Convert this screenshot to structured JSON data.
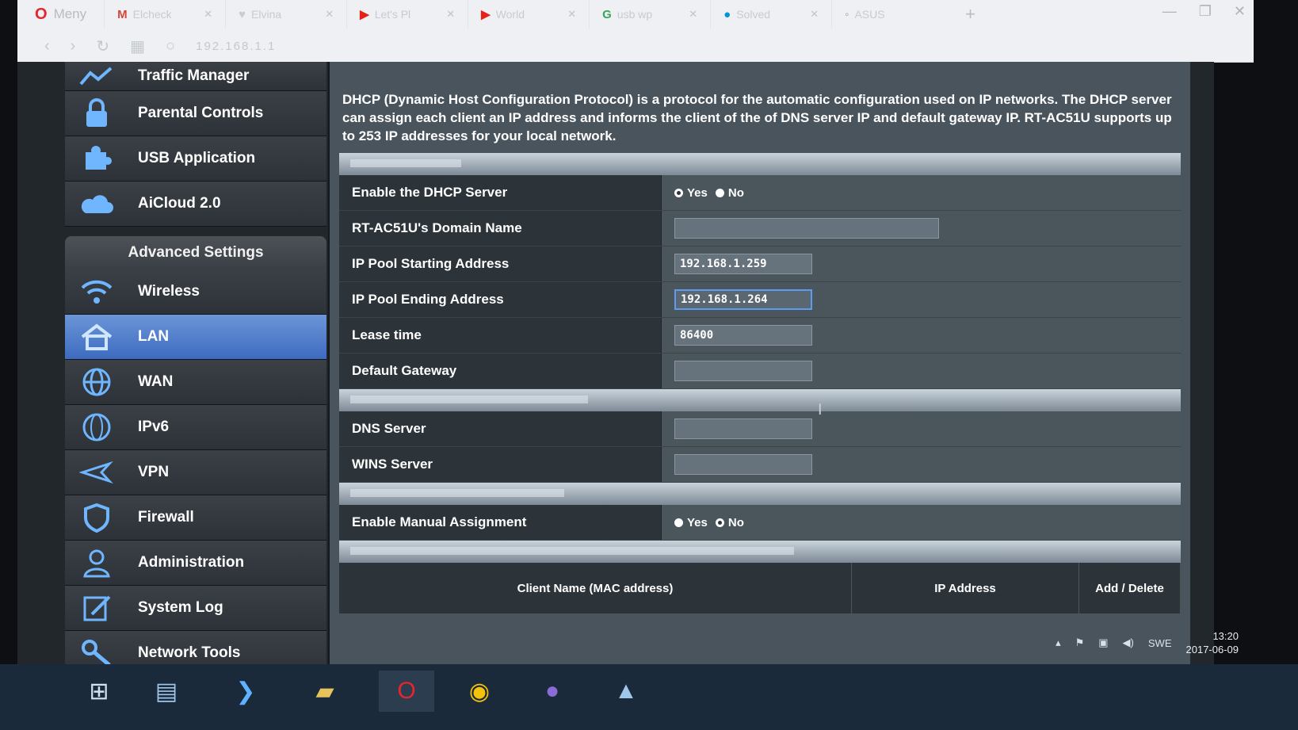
{
  "browser": {
    "menu_label": "Meny",
    "tabs": [
      {
        "label": "Elcheck",
        "icon": "gmail-icon"
      },
      {
        "label": "Elvina",
        "icon": "heart-icon"
      },
      {
        "label": "Let's Pl",
        "icon": "youtube-icon"
      },
      {
        "label": "World",
        "icon": "youtube-icon"
      },
      {
        "label": "usb wp",
        "icon": "google-icon"
      },
      {
        "label": "Solved",
        "icon": "hp-icon"
      },
      {
        "label": "ASUS",
        "icon": "asus-icon"
      }
    ],
    "address": "192.168.1.1"
  },
  "sidebar": {
    "top_items": [
      {
        "label": "Traffic Manager",
        "icon": "traffic-icon"
      },
      {
        "label": "Parental Controls",
        "icon": "lock-icon"
      },
      {
        "label": "USB Application",
        "icon": "puzzle-icon"
      },
      {
        "label": "AiCloud 2.0",
        "icon": "cloud-icon"
      }
    ],
    "advanced_heading": "Advanced Settings",
    "advanced_items": [
      {
        "label": "Wireless",
        "icon": "wifi-icon"
      },
      {
        "label": "LAN",
        "icon": "home-icon",
        "active": true
      },
      {
        "label": "WAN",
        "icon": "globe-icon"
      },
      {
        "label": "IPv6",
        "icon": "ipv6-icon"
      },
      {
        "label": "VPN",
        "icon": "vpn-icon"
      },
      {
        "label": "Firewall",
        "icon": "shield-icon"
      },
      {
        "label": "Administration",
        "icon": "user-icon"
      },
      {
        "label": "System Log",
        "icon": "log-icon"
      },
      {
        "label": "Network Tools",
        "icon": "tools-icon"
      }
    ]
  },
  "main": {
    "description": "DHCP (Dynamic Host Configuration Protocol) is a protocol for the automatic configuration used on IP networks. The DHCP server can assign each client an IP address and informs the client of the of DNS server IP and default gateway IP. RT-AC51U supports up to 253 IP addresses for your local network.",
    "basic": {
      "section_title": "Basic Config",
      "enable_dhcp_label": "Enable the DHCP Server",
      "yes": "Yes",
      "no": "No",
      "domain_label": "RT-AC51U's Domain Name",
      "domain_value": "",
      "pool_start_label": "IP Pool Starting Address",
      "pool_start_value": "192.168.1.259",
      "pool_end_label": "IP Pool Ending Address",
      "pool_end_value": "192.168.1.264",
      "lease_label": "Lease time",
      "lease_value": "86400",
      "gateway_label": "Default Gateway",
      "gateway_value": ""
    },
    "dns": {
      "section_title": "DNS and WINS Server Setting",
      "dns_label": "DNS Server",
      "dns_value": "",
      "wins_label": "WINS Server",
      "wins_value": ""
    },
    "manual": {
      "section_title": "Enable Manual Assignment",
      "enable_label": "Enable Manual Assignment",
      "yes": "Yes",
      "no": "No",
      "list_title": "Manually Assigned IP around the DHCP list (Max Limit : 64)",
      "col_client": "Client Name (MAC address)",
      "col_ip": "IP Address",
      "col_add": "Add / Delete"
    }
  },
  "taskbar": {
    "language": "SWE",
    "time": "13:20",
    "date": "2017-06-09"
  }
}
